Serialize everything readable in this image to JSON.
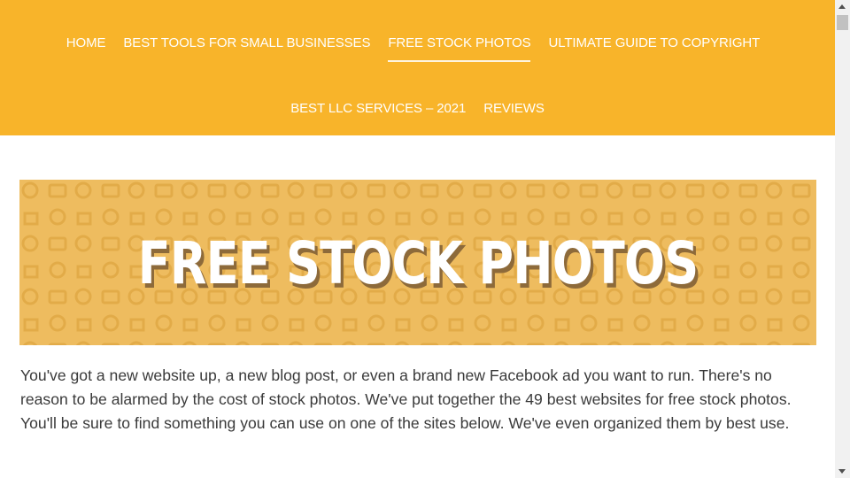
{
  "nav": {
    "items": [
      {
        "label": "HOME"
      },
      {
        "label": "BEST TOOLS FOR SMALL BUSINESSES"
      },
      {
        "label": "FREE STOCK PHOTOS",
        "active": true
      },
      {
        "label": "ULTIMATE GUIDE TO COPYRIGHT"
      },
      {
        "label": "BEST LLC SERVICES – 2021"
      },
      {
        "label": "REVIEWS"
      }
    ]
  },
  "banner": {
    "title": "FREE STOCK PHOTOS"
  },
  "intro": {
    "text": "You've got a new website up, a new blog post, or even a brand new Facebook ad you want to run. There's no reason to be alarmed by the cost of stock photos. We've put together the 49 best websites for free stock photos. You'll be sure to find something you can use on one of the sites below. We've even organized them by best use."
  },
  "colors": {
    "header_bg": "#f8b42a",
    "banner_bg": "#eebc5f",
    "text": "#3a3a3a"
  }
}
